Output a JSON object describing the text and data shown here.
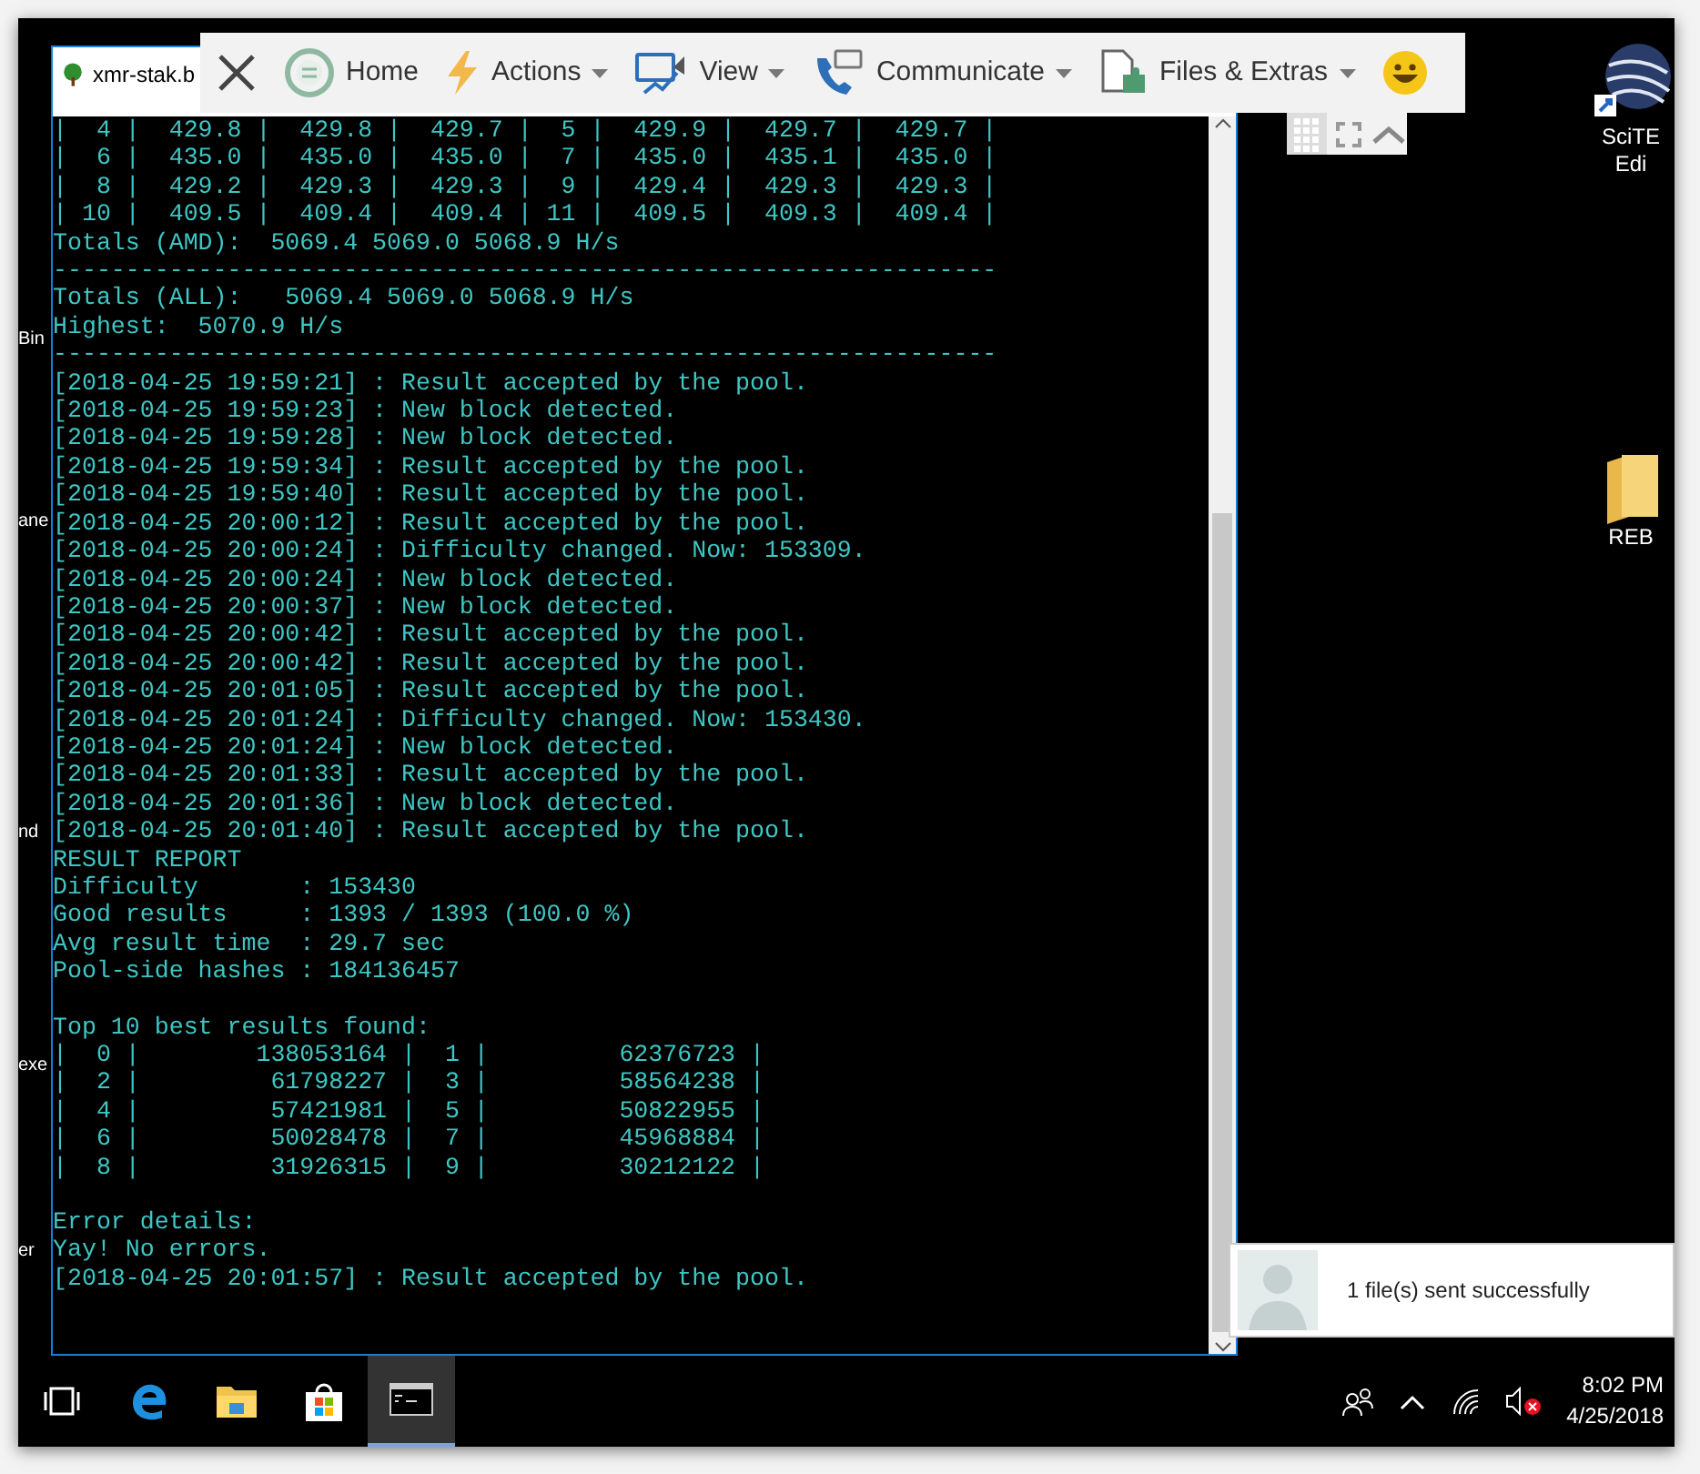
{
  "desktop_left_labels": [
    "Bin",
    "ane",
    "nd",
    "exe",
    "er"
  ],
  "desktop_icons": [
    {
      "kind": "app",
      "label_lines": [
        "SciTE",
        "Edi"
      ]
    },
    {
      "kind": "folder",
      "label_lines": [
        "REB"
      ]
    }
  ],
  "console": {
    "tab_title": "xmr-stak.b",
    "sections": [
      {
        "lines": [
          "|  4 |  429.8 |  429.8 |  429.7 |  5 |  429.9 |  429.7 |  429.7 |",
          "|  6 |  435.0 |  435.0 |  435.0 |  7 |  435.0 |  435.1 |  435.0 |",
          "|  8 |  429.2 |  429.3 |  429.3 |  9 |  429.4 |  429.3 |  429.3 |",
          "| 10 |  409.5 |  409.4 |  409.4 | 11 |  409.5 |  409.3 |  409.4 |",
          "Totals (AMD):  5069.4 5069.0 5068.9 H/s",
          "-----------------------------------------------------------------",
          "Totals (ALL):   5069.4 5069.0 5068.9 H/s",
          "Highest:  5070.9 H/s",
          "-----------------------------------------------------------------",
          "[2018-04-25 19:59:21] : Result accepted by the pool.",
          "[2018-04-25 19:59:23] : New block detected.",
          "[2018-04-25 19:59:28] : New block detected.",
          "[2018-04-25 19:59:34] : Result accepted by the pool.",
          "[2018-04-25 19:59:40] : Result accepted by the pool.",
          "[2018-04-25 20:00:12] : Result accepted by the pool.",
          "[2018-04-25 20:00:24] : Difficulty changed. Now: 153309.",
          "[2018-04-25 20:00:24] : New block detected.",
          "[2018-04-25 20:00:37] : New block detected.",
          "[2018-04-25 20:00:42] : Result accepted by the pool.",
          "[2018-04-25 20:00:42] : Result accepted by the pool.",
          "[2018-04-25 20:01:05] : Result accepted by the pool.",
          "[2018-04-25 20:01:24] : Difficulty changed. Now: 153430.",
          "[2018-04-25 20:01:24] : New block detected.",
          "[2018-04-25 20:01:33] : Result accepted by the pool.",
          "[2018-04-25 20:01:36] : New block detected.",
          "[2018-04-25 20:01:40] : Result accepted by the pool.",
          "RESULT REPORT",
          "Difficulty       : 153430",
          "Good results     : 1393 / 1393 (100.0 %)",
          "Avg result time  : 29.7 sec",
          "Pool-side hashes : 184136457"
        ]
      },
      {
        "lines": [
          "Top 10 best results found:",
          "|  0 |        138053164 |  1 |         62376723 |",
          "|  2 |         61798227 |  3 |         58564238 |",
          "|  4 |         57421981 |  5 |         50822955 |",
          "|  6 |         50028478 |  7 |         45968884 |",
          "|  8 |         31926315 |  9 |         30212122 |"
        ]
      },
      {
        "lines": [
          "Error details:",
          "Yay! No errors.",
          "[2018-04-25 20:01:57] : Result accepted by the pool."
        ]
      }
    ]
  },
  "remote_toolbar": {
    "items": [
      {
        "kind": "close"
      },
      {
        "kind": "home",
        "label": "Home",
        "has_menu": false
      },
      {
        "kind": "actions",
        "label": "Actions",
        "has_menu": true
      },
      {
        "kind": "view",
        "label": "View",
        "has_menu": true
      },
      {
        "kind": "communicate",
        "label": "Communicate",
        "has_menu": true
      },
      {
        "kind": "files",
        "label": "Files & Extras",
        "has_menu": true
      },
      {
        "kind": "emoji"
      }
    ]
  },
  "notification": {
    "message": "1 file(s) sent successfully"
  },
  "taskbar": {
    "apps": [
      {
        "kind": "task-view",
        "selected": false
      },
      {
        "kind": "browser",
        "selected": false
      },
      {
        "kind": "folder",
        "selected": false
      },
      {
        "kind": "store",
        "selected": false
      },
      {
        "kind": "terminal",
        "selected": true
      }
    ],
    "time": "8:02 PM",
    "date": "4/25/2018"
  }
}
